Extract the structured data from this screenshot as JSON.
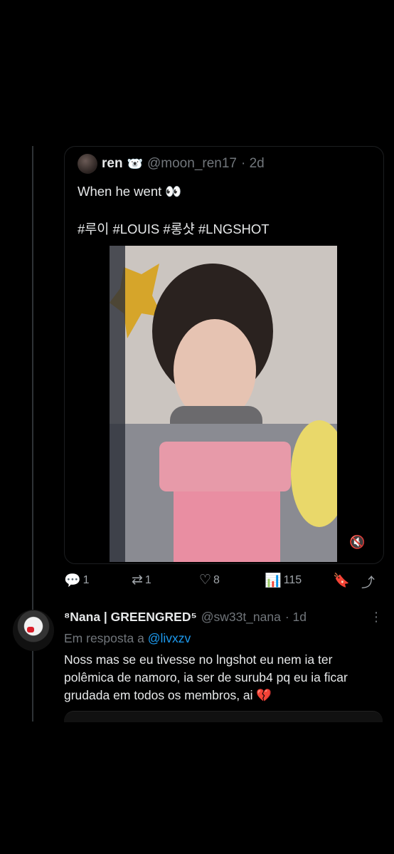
{
  "quoted_tweet": {
    "name": "ren",
    "name_emoji": "🐻‍❄️",
    "handle": "@moon_ren17",
    "time": "· 2d",
    "text": "When he went 👀",
    "hashtags": "#루이 #LOUIS #롱샷 #LNGSHOT",
    "mute_icon": "🔇"
  },
  "actions": {
    "replies": "1",
    "retweets": "1",
    "likes": "8",
    "views": "115",
    "icons": {
      "reply": "reply-icon",
      "retweet": "retweet-icon",
      "like": "heart-icon",
      "views": "views-icon",
      "bookmark": "bookmark-icon",
      "share": "share-icon"
    }
  },
  "reply_tweet": {
    "name": "⁸Nana | GREENGRED⁵",
    "handle": "@sw33t_nana",
    "time": "· 1d",
    "more_icon": "⋮",
    "reply_prefix": "Em resposta a",
    "reply_to": "@livxzv",
    "text": "Noss mas se eu tivesse no lngshot eu nem ia ter polêmica de namoro, ia ser de surub4 pq eu ia ficar grudada em todos os membros, ai 💔"
  }
}
